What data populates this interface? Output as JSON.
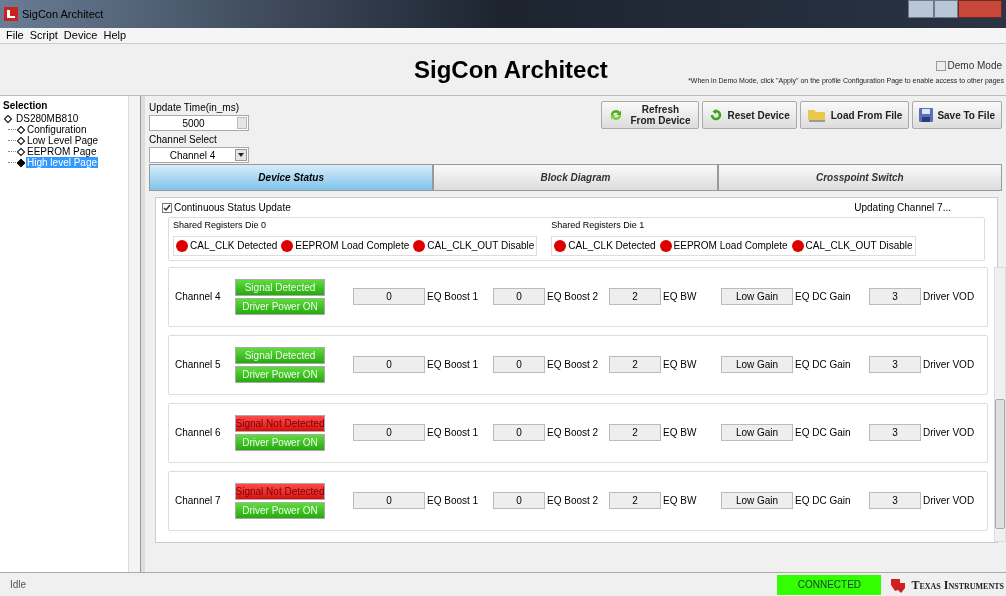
{
  "window": {
    "title": "SigCon Architect"
  },
  "menu": [
    "File",
    "Script",
    "Device",
    "Help"
  ],
  "header": {
    "title": "SigCon Architect",
    "demo_mode": {
      "label": "Demo Mode",
      "checked": false
    },
    "note": "*When in Demo Mode, click \"Apply\" on the profile Configuration Page to enable access to other pages"
  },
  "sidebar": {
    "title": "Selection",
    "tree": [
      {
        "label": "DS280MB810",
        "selected": false,
        "children": [
          {
            "label": "Configuration",
            "selected": false
          },
          {
            "label": "Low Level Page",
            "selected": false
          },
          {
            "label": "EEPROM Page",
            "selected": false
          },
          {
            "label": "High level Page",
            "selected": true
          }
        ]
      }
    ]
  },
  "controls": {
    "update_time_label": "Update Time(in_ms)",
    "update_time": "5000",
    "channel_select_label": "Channel Select",
    "channel_select": "Channel 4"
  },
  "buttons": [
    {
      "label": "Refresh From Device",
      "kind": "refresh"
    },
    {
      "label": "Reset Device",
      "kind": "reset"
    },
    {
      "label": "Load From File",
      "kind": "load"
    },
    {
      "label": "Save To File",
      "kind": "save"
    }
  ],
  "tabs": [
    {
      "label": "Device Status",
      "selected": true
    },
    {
      "label": "Block Diagram",
      "selected": false
    },
    {
      "label": "Crosspoint Switch",
      "selected": false
    }
  ],
  "status": {
    "continuous_update": {
      "label": "Continuous Status Update",
      "checked": true
    },
    "updating": "Updating Channel 7...",
    "shared": [
      {
        "title": "Shared Registers Die 0",
        "leds": [
          {
            "label": "CAL_CLK Detected",
            "color": "#dd0000"
          },
          {
            "label": "EEPROM Load Complete",
            "color": "#dd0000"
          },
          {
            "label": "CAL_CLK_OUT Disable",
            "color": "#dd0000"
          }
        ]
      },
      {
        "title": "Shared Registers Die 1",
        "leds": [
          {
            "label": "CAL_CLK Detected",
            "color": "#dd0000"
          },
          {
            "label": "EEPROM Load Complete",
            "color": "#dd0000"
          },
          {
            "label": "CAL_CLK_OUT Disable",
            "color": "#dd0000"
          }
        ]
      }
    ],
    "channels": [
      {
        "name": "Channel 4",
        "signal": {
          "label": "Signal Detected",
          "detected": true
        },
        "power": {
          "label": "Driver Power ON",
          "on": true
        },
        "fields": [
          {
            "value": "0",
            "label": "EQ Boost 1"
          },
          {
            "value": "0",
            "label": "EQ Boost 2"
          },
          {
            "value": "2",
            "label": "EQ BW"
          },
          {
            "value": "Low Gain",
            "label": "EQ DC Gain"
          },
          {
            "value": "3",
            "label": "Driver VOD"
          }
        ]
      },
      {
        "name": "Channel 5",
        "signal": {
          "label": "Signal Detected",
          "detected": true
        },
        "power": {
          "label": "Driver Power ON",
          "on": true
        },
        "fields": [
          {
            "value": "0",
            "label": "EQ Boost 1"
          },
          {
            "value": "0",
            "label": "EQ Boost 2"
          },
          {
            "value": "2",
            "label": "EQ BW"
          },
          {
            "value": "Low Gain",
            "label": "EQ DC Gain"
          },
          {
            "value": "3",
            "label": "Driver VOD"
          }
        ]
      },
      {
        "name": "Channel 6",
        "signal": {
          "label": "Signal Not Detected",
          "detected": false
        },
        "power": {
          "label": "Driver Power ON",
          "on": true
        },
        "fields": [
          {
            "value": "0",
            "label": "EQ Boost 1"
          },
          {
            "value": "0",
            "label": "EQ Boost 2"
          },
          {
            "value": "2",
            "label": "EQ BW"
          },
          {
            "value": "Low Gain",
            "label": "EQ DC Gain"
          },
          {
            "value": "3",
            "label": "Driver VOD"
          }
        ]
      },
      {
        "name": "Channel 7",
        "signal": {
          "label": "Signal Not Detected",
          "detected": false
        },
        "power": {
          "label": "Driver Power ON",
          "on": true
        },
        "fields": [
          {
            "value": "0",
            "label": "EQ Boost 1"
          },
          {
            "value": "0",
            "label": "EQ Boost 2"
          },
          {
            "value": "2",
            "label": "EQ BW"
          },
          {
            "value": "Low Gain",
            "label": "EQ DC Gain"
          },
          {
            "value": "3",
            "label": "Driver VOD"
          }
        ]
      }
    ]
  },
  "status_bar": {
    "text": "Idle",
    "connection": "CONNECTED",
    "connected": true,
    "brand": "Texas Instruments"
  }
}
